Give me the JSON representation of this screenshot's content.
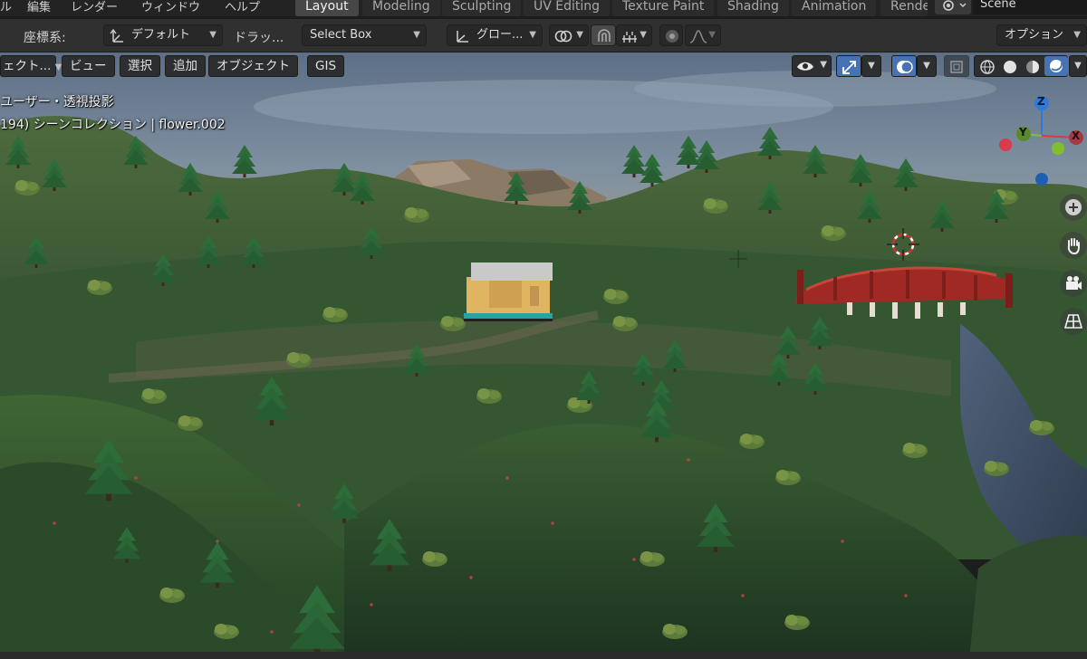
{
  "topbar": {
    "menus": [
      "ル",
      "編集",
      "レンダー",
      "ウィンドウ",
      "ヘルプ"
    ],
    "workspaces": [
      "Layout",
      "Modeling",
      "Sculpting",
      "UV Editing",
      "Texture Paint",
      "Shading",
      "Animation",
      "Rende"
    ],
    "active_workspace": "Layout",
    "scene_name": "Scene"
  },
  "header": {
    "orientation_label": "座標系:",
    "orientation_value": "デフォルト",
    "drag_label": "ドラッ...",
    "drag_value": "Select Box",
    "transform_orientation": "グロー...",
    "options_label": "オプション"
  },
  "viewport_header": {
    "mode_label": "ェクト...",
    "menus": [
      "ビュー",
      "選択",
      "追加",
      "オブジェクト",
      "GIS"
    ]
  },
  "viewport_info": {
    "view_name": "ユーザー・透視投影",
    "collection_line": "194) シーンコレクション | flower.002"
  },
  "gizmo": {
    "z_label": "Z",
    "y_label": "Y",
    "x_label": "X",
    "colors": {
      "x": "#d93b4d",
      "y": "#7fbf2d",
      "z": "#2f7ad9"
    }
  },
  "icons": {
    "visibility": "eye-icon",
    "gizmo": "transform-gizmo-icon",
    "overlays": "overlay-icon",
    "xray": "xray-icon",
    "shading": [
      "wireframe-icon",
      "solid-icon",
      "material-preview-icon",
      "rendered-icon"
    ],
    "navigation": [
      "zoom-icon",
      "hand-pan-icon",
      "camera-icon",
      "grid-view-icon"
    ]
  }
}
